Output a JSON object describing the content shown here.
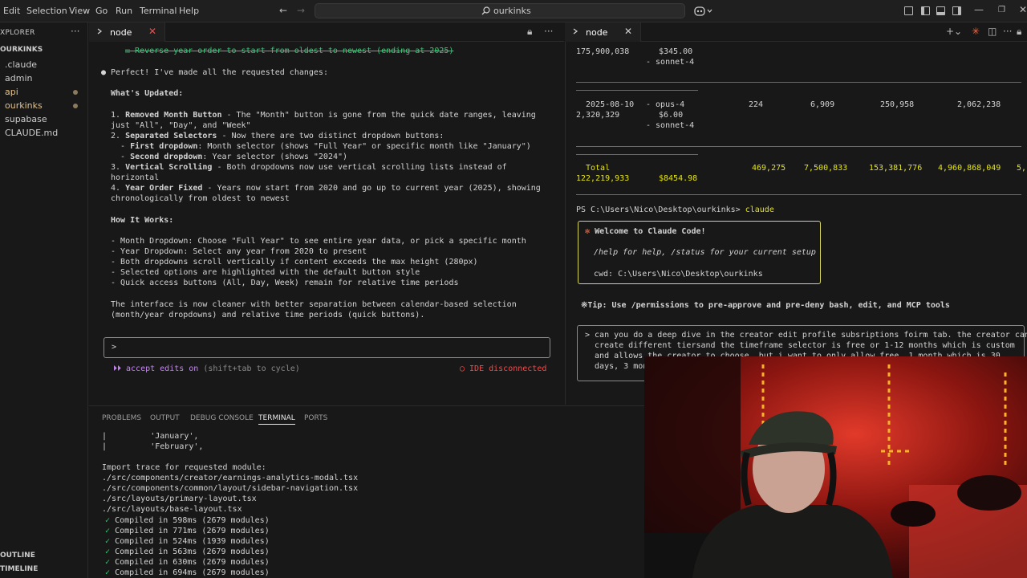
{
  "menu": {
    "items": [
      "Edit",
      "Selection",
      "View",
      "Go",
      "Run",
      "Terminal",
      "Help"
    ]
  },
  "search": {
    "text": "ourkinks",
    "icon": "search-icon"
  },
  "sidebar": {
    "title": "XPLORER",
    "project": "OURKINKS",
    "items": [
      {
        "label": ".claude",
        "modified": false
      },
      {
        "label": "admin",
        "modified": false
      },
      {
        "label": "api",
        "modified": true
      },
      {
        "label": "ourkinks",
        "modified": true
      },
      {
        "label": "supabase",
        "modified": false
      },
      {
        "label": "CLAUDE.md",
        "modified": false
      }
    ],
    "sections": [
      "OUTLINE",
      "TIMELINE"
    ]
  },
  "tabs": {
    "left": {
      "label": "node"
    },
    "right": {
      "label": "node"
    }
  },
  "left_pane": {
    "top_line": "☒ Reverse year order to start from oldest to newest (ending at 2025)",
    "intro": "● Perfect! I've made all the requested changes:",
    "whats_updated": "What's Updated:",
    "items": [
      {
        "num": "1. ",
        "title": "Removed Month Button",
        "text": " - The \"Month\" button is gone from the quick date ranges, leaving"
      },
      {
        "cont": "just \"All\", \"Day\", and \"Week\""
      },
      {
        "num": "2. ",
        "title": "Separated Selectors",
        "text": " - Now there are two distinct dropdown buttons:"
      },
      {
        "num": "  - ",
        "title": "First dropdown",
        "text": ": Month selector (shows \"Full Year\" or specific month like \"January\")"
      },
      {
        "num": "  - ",
        "title": "Second dropdown",
        "text": ": Year selector (shows \"2024\")"
      },
      {
        "num": "3. ",
        "title": "Vertical Scrolling",
        "text": " - Both dropdowns now use vertical scrolling lists instead of"
      },
      {
        "cont": "horizontal"
      },
      {
        "num": "4. ",
        "title": "Year Order Fixed",
        "text": " - Years now start from 2020 and go up to current year (2025), showing"
      },
      {
        "cont": "chronologically from oldest to newest"
      }
    ],
    "how_it_works": "How It Works:",
    "how_items": [
      {
        "title": "Month Dropdown",
        "text": ": Choose \"Full Year\" to see entire year data, or pick a specific month"
      },
      {
        "title": "Year Dropdown",
        "text": ": Select any year from 2020 to present"
      },
      {
        "title": "",
        "text": "Both dropdowns scroll vertically if content exceeds the max height (280px)"
      },
      {
        "title": "",
        "text": "Selected options are highlighted with the default button style"
      },
      {
        "title": "",
        "text": "Quick access buttons (All, Day, Week) remain for relative time periods"
      }
    ],
    "summary_1": "The interface is now cleaner with better separation between calendar-based selection",
    "summary_2": "(month/year dropdowns) and relative time periods (quick buttons).",
    "prompt_caret": ">",
    "accept_edits": "⏵⏵ accept edits on",
    "accept_hint": " (shift+tab to cycle)",
    "ide_status": "◯ IDE disconnected"
  },
  "right_pane": {
    "rows": [
      {
        "a": "175,900,038",
        "b": "$345.00",
        "c": ""
      },
      {
        "a": "",
        "b": "- sonnet-4",
        "c": ""
      }
    ],
    "row2": {
      "date": "2025-08-10",
      "model1": "- opus-4",
      "input": "224",
      "output": "6,909",
      "cache_create": "250,958",
      "cache_read": "2,062,238",
      "total": "2,320,329",
      "cost": "$6.00",
      "model2": "- sonnet-4"
    },
    "total": {
      "label": "Total",
      "input": "469,275",
      "output": "7,500,833",
      "cache_create": "153,381,776",
      "cache_read": "4,960,868,049",
      "trail": "5,",
      "total_tokens": "122,219,933",
      "cost": "$8454.98"
    },
    "ps_prompt": "PS C:\\Users\\Nico\\Desktop\\ourkinks>",
    "ps_cmd": " claude",
    "welcome": {
      "title": "Welcome to Claude Code!",
      "help": "/help for help, /status for your current setup",
      "cwd": "cwd: C:\\Users\\Nico\\Desktop\\ourkinks"
    },
    "tip": "※Tip: Use /permissions to pre-approve and pre-deny bash, edit, and MCP tools",
    "input_lines": [
      "> can you do a deep dive in the creator edit profile subsriptions foirm tab. the creator can",
      "  create different tiersand the timeframe selector is free or 1-12 months which is custom",
      "  and allows the creator to choose. but i want to only allow free, 1 month which is 30",
      "  days, 3 mon"
    ]
  },
  "panel": {
    "tabs": [
      "PROBLEMS",
      "OUTPUT",
      "DEBUG CONSOLE",
      "TERMINAL",
      "PORTS"
    ],
    "active": "TERMINAL",
    "lines": [
      "|         'January',",
      "|         'February',",
      "",
      "Import trace for requested module:",
      "./src/components/creator/earnings-analytics-modal.tsx",
      "./src/components/common/layout/sidebar-navigation.tsx",
      "./src/layouts/primary-layout.tsx",
      "./src/layouts/base-layout.tsx"
    ],
    "compiled": [
      "Compiled in 598ms (2679 modules)",
      "Compiled in 771ms (2679 modules)",
      "Compiled in 524ms (1939 modules)",
      "Compiled in 563ms (2679 modules)",
      "Compiled in 630ms (2679 modules)",
      "Compiled in 694ms (2679 modules)"
    ]
  }
}
